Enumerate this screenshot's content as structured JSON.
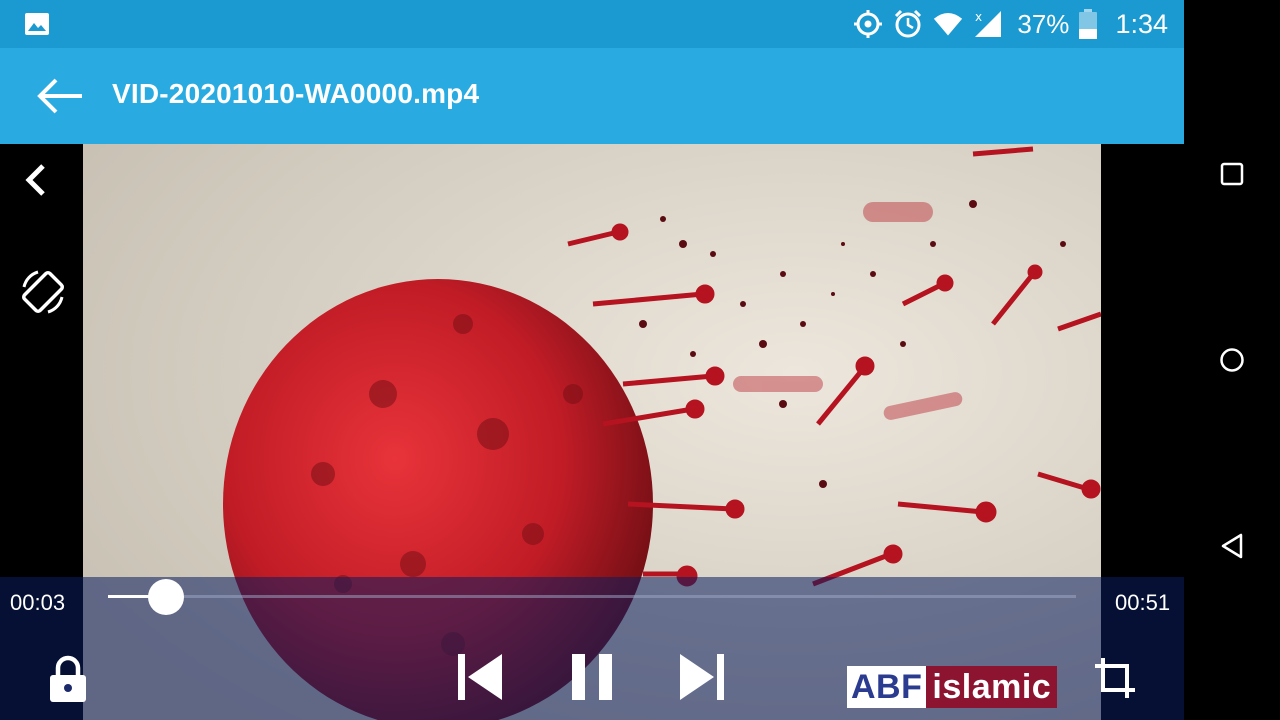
{
  "status_bar": {
    "battery_percent": "37%",
    "battery_level": 0.37,
    "time": "1:34",
    "icons": [
      "image-notification-icon",
      "location-icon",
      "alarm-icon",
      "wifi-icon",
      "signal-icon",
      "battery-icon"
    ]
  },
  "app_bar": {
    "title": "VID-20201010-WA0000.mp4"
  },
  "player": {
    "current_time": "00:03",
    "total_time": "00:51",
    "progress_fraction": 0.06,
    "watermark": {
      "part1": "ABF",
      "part2": "islamic"
    }
  },
  "colors": {
    "status_bar": "#1a9ad0",
    "app_bar": "#29abe2",
    "controls_overlay": "#0a1e5f"
  }
}
